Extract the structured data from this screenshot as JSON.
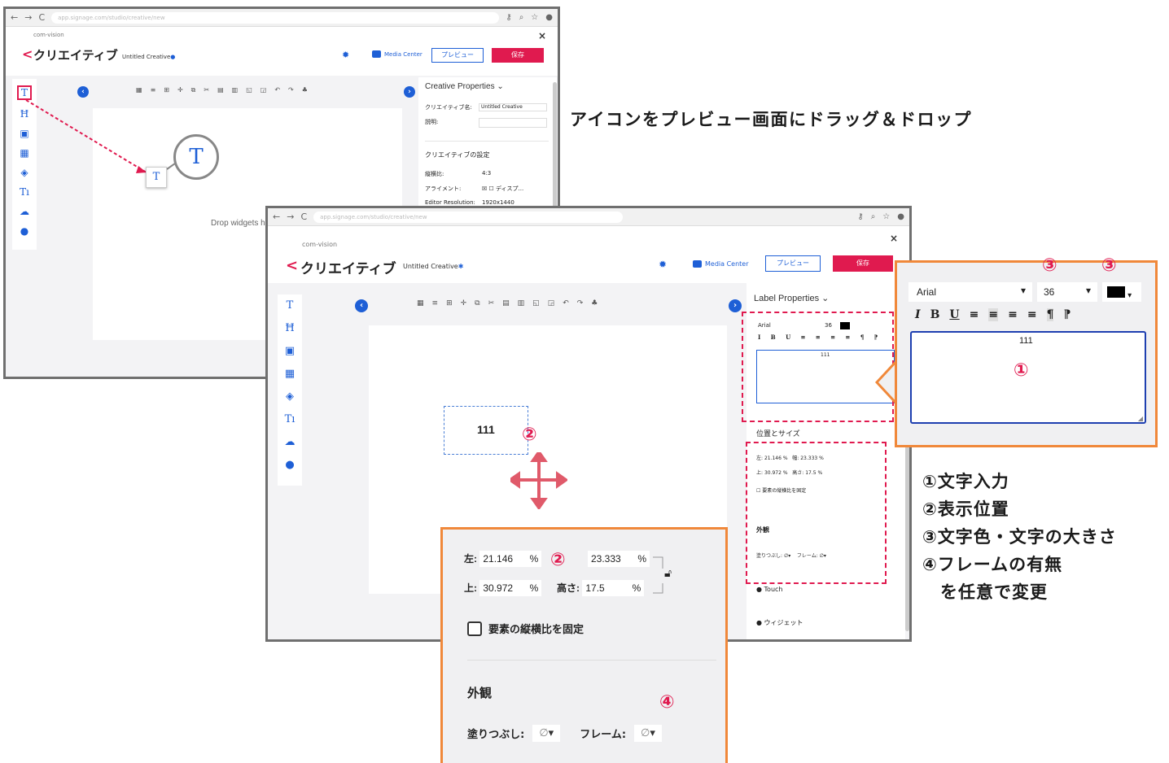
{
  "browser": {
    "url_text": "app.signage.com/studio/creative/new"
  },
  "app": {
    "brand": "com-vision",
    "back_arrow": "<",
    "page_title": "クリエイティブ",
    "untitled": "Untitled Creative",
    "media_center": "Media Center",
    "preview_button": "プレビュー",
    "save_button": "保存",
    "close": "×"
  },
  "window1": {
    "panel_title": "Creative Properties",
    "fields": [
      {
        "label": "クリエイティブ名:",
        "value": "Untitled Creative"
      },
      {
        "label": "説明:",
        "value": ""
      }
    ],
    "section_title": "クリエイティブの設定",
    "settings": [
      {
        "label": "縦横比:",
        "value": "4:3"
      },
      {
        "label": "アライメント:",
        "value": "ディスプ..."
      },
      {
        "label": "Editor Resolution:",
        "value": "1920x1440"
      }
    ],
    "canvas_hint": "Drop widgets h",
    "dragged_icon": "T"
  },
  "window2": {
    "panel_title": "Label Properties",
    "font": "Arial",
    "size": "36",
    "text_value": "111",
    "section_position": "位置とサイズ",
    "pos_small": {
      "left": "21.146",
      "width": "23.333",
      "top": "30.972",
      "height": "17.5"
    },
    "lock_small": "要素の縦横比を固定",
    "appearance_small": "外観",
    "fill_label_small": "塗りつぶし:",
    "frame_label_small": "フレーム:",
    "touch": "Touch",
    "widget": "ウィジェット",
    "canvas_label_text": "111"
  },
  "zoom_top": {
    "font": "Arial",
    "size": "36",
    "text_value": "111",
    "format_buttons": [
      "I",
      "B",
      "U"
    ]
  },
  "zoom_bottom": {
    "left_label": "左:",
    "left_value": "21.146",
    "width_value": "23.333",
    "top_label": "上:",
    "top_value": "30.972",
    "height_label": "高さ:",
    "height_value": "17.5",
    "percent": "%",
    "lock_label": "要素の縦横比を固定",
    "appearance": "外観",
    "fill_label": "塗りつぶし:",
    "frame_label": "フレーム:",
    "none_symbol": "∅"
  },
  "annotations": {
    "caption": "アイコンをプレビュー画面にドラッグ＆ドロップ",
    "marker_1": "①",
    "marker_2": "②",
    "marker_3": "③",
    "marker_4": "④",
    "legend": [
      "①文字入力",
      "②表示位置",
      "③文字色・文字の大きさ",
      "④フレームの有無",
      "　を任意で変更"
    ]
  },
  "colors": {
    "accent_blue": "#1e5fd6",
    "accent_red": "#e01a4f",
    "callout_orange": "#f0883a"
  }
}
